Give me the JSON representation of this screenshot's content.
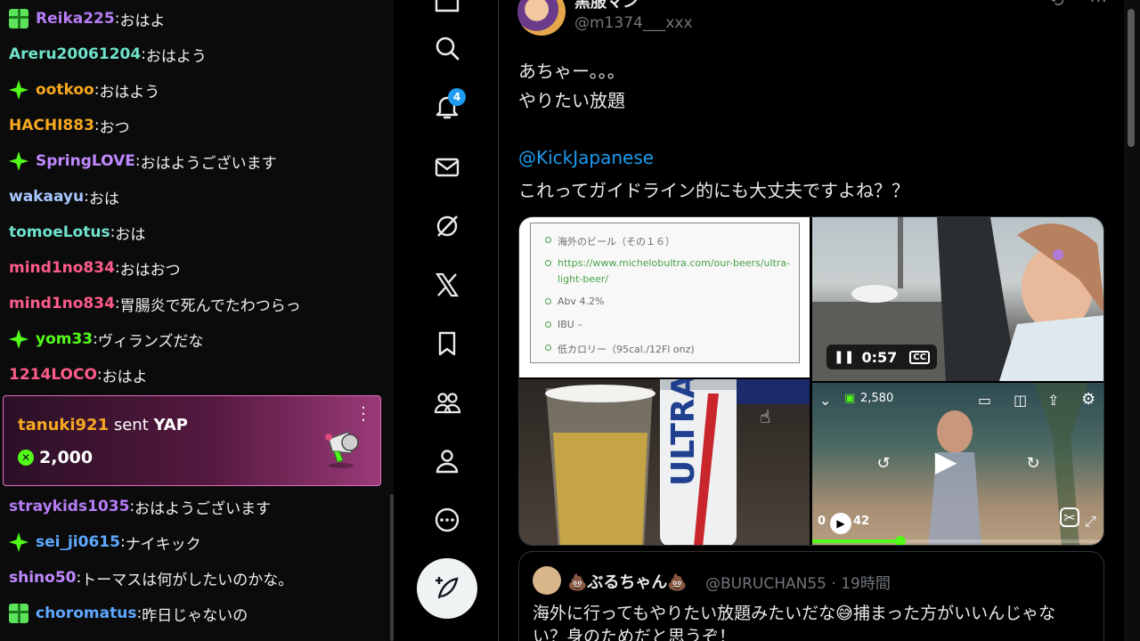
{
  "chat": {
    "lines": [
      {
        "badge": "gift-badge-icon",
        "user": "Reika225",
        "color": "#b67df5",
        "message": "おはよ"
      },
      {
        "badge": "",
        "user": "Areru20061204",
        "color": "#6fe3c9",
        "message": "おはよう"
      },
      {
        "badge": "sparkle-badge-icon",
        "user": "ootkoo",
        "color": "#f6a821",
        "message": "おはよう"
      },
      {
        "badge": "",
        "user": "HACHI883",
        "color": "#f6a821",
        "message": "おつ"
      },
      {
        "badge": "sparkle-badge-icon",
        "user": "SpringLOVE",
        "color": "#c089ff",
        "message": "おはようございます"
      },
      {
        "badge": "",
        "user": "wakaayu",
        "color": "#a8c8ff",
        "message": "おは"
      },
      {
        "badge": "",
        "user": "tomoeLotus",
        "color": "#6fe3c9",
        "message": "おは"
      },
      {
        "badge": "",
        "user": "mind1no834",
        "color": "#ff5c8a",
        "message": "おはおつ"
      },
      {
        "badge": "",
        "user": "mind1no834",
        "color": "#ff5c8a",
        "message": "胃腸炎で死んでたわつらっ"
      },
      {
        "badge": "sparkle-badge-icon",
        "user": "yom33",
        "color": "#53fc18",
        "message": "ヴィランズだな"
      },
      {
        "badge": "",
        "user": "1214LOCO",
        "color": "#ff5c8a",
        "message": "おはよ"
      },
      {
        "badge": "",
        "user": "straykids1035",
        "color": "#b67df5",
        "message": "おはようございます"
      },
      {
        "badge": "sparkle-badge-icon",
        "user": "sei_ji0615",
        "color": "#5ea8ff",
        "message": "ナイキック"
      },
      {
        "badge": "",
        "user": "shino50",
        "color": "#c089ff",
        "message": "トーマスは何がしたいのかな。"
      },
      {
        "badge": "gift-badge-icon",
        "user": "choromatus",
        "color": "#5ea8ff",
        "message": "昨日じゃないの"
      }
    ],
    "gift": {
      "sender": "tanuki921",
      "verb": "sent",
      "item": "YAP",
      "amount": "2,000"
    }
  },
  "nav": {
    "notification_count": "4",
    "icons": [
      "home-icon",
      "search-icon",
      "bell-icon",
      "mail-icon",
      "grok-icon",
      "x-logo-icon",
      "bookmark-icon",
      "communities-icon",
      "profile-icon",
      "more-icon",
      "post-icon"
    ]
  },
  "tweet": {
    "author_name": "黒服マン",
    "author_handle": "@m1374___xxx",
    "text_line1": "あちゃー。。。",
    "text_line2": "やりたい放題",
    "mention": "@KickJapanese",
    "text_line3": "これってガイドライン的にも大丈夫ですよね？？",
    "doc": {
      "items": [
        "海外のビール（その１６）",
        "https://www.michelobultra.com/our-beers/ultra-",
        "light-beer/",
        "Abv 4.2%",
        "IBU –",
        "低カロリー（95cal./12Fl onz)"
      ]
    },
    "beer_can_text": "ULTRA",
    "video1": {
      "time": "0:57"
    },
    "video2": {
      "viewers": "2,580",
      "time_partial": "0",
      "time_end": "42",
      "progress": 0.3
    }
  },
  "quote": {
    "name": "💩ぶるちゃん💩",
    "handle_time": "@BURUCHAN55 · 19時間",
    "line1": "海外に行ってもやりたい放題みたいだな😅捕まった方がいいんじゃな",
    "line2": "い？身のためだと思うぞ！"
  }
}
